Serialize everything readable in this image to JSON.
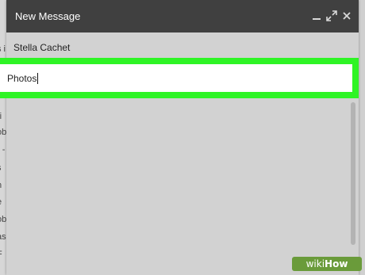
{
  "compose": {
    "title": "New Message",
    "to_value": "Stella Cachet",
    "subject_value": "Photos"
  },
  "controls": {
    "minimize_icon": "minimize-icon",
    "expand_icon": "expand-icon",
    "close_icon": "close-icon"
  },
  "highlight_color": "#2ef425",
  "background_fragments": [
    "s i",
    "ri",
    "ob",
    "- -",
    "s",
    "n",
    "e",
    "ri",
    "ob",
    "as",
    "F"
  ],
  "watermark": {
    "prefix": "wiki",
    "suffix": "How"
  }
}
